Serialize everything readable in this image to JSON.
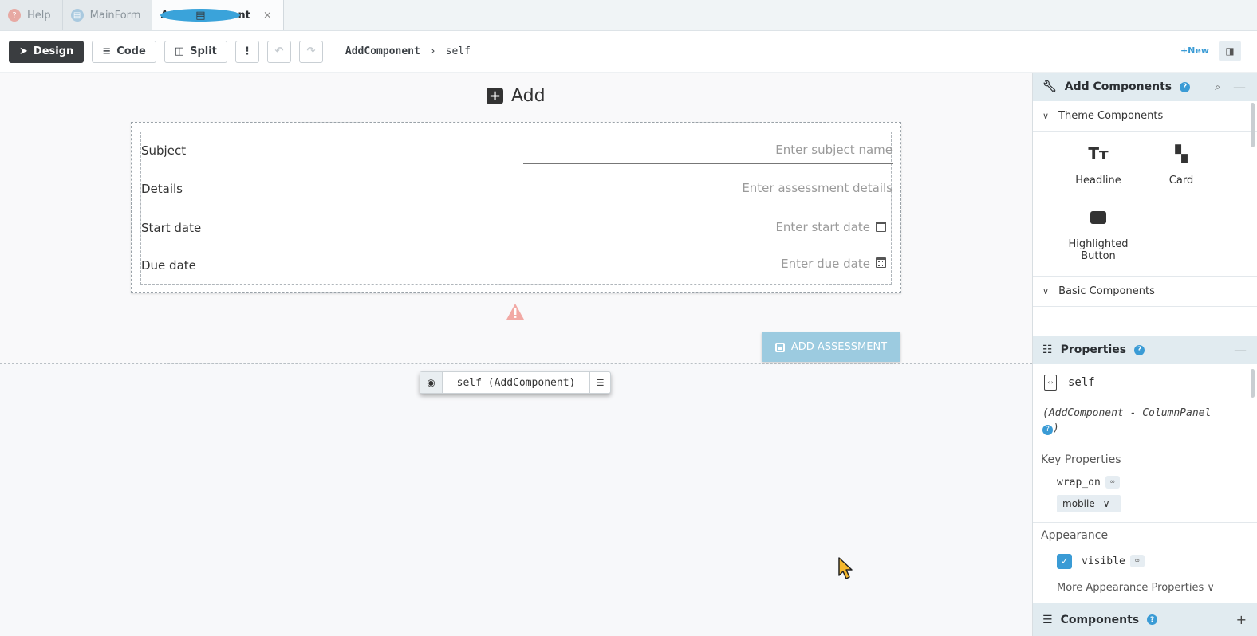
{
  "tabs": [
    {
      "label": "Help",
      "icon": "help-icon"
    },
    {
      "label": "MainForm",
      "icon": "form-icon"
    },
    {
      "label": "AddComponent",
      "icon": "component-icon",
      "close": "×"
    }
  ],
  "toolbar": {
    "design": "Design",
    "code": "Code",
    "split": "Split",
    "more": "⋮",
    "undo": "↶",
    "redo": "↷",
    "crumb_form": "AddComponent",
    "crumb_sep": "›",
    "crumb_self": "self",
    "new": "+New"
  },
  "form": {
    "title": "Add",
    "rows": [
      {
        "label": "Subject",
        "placeholder": "Enter subject name"
      },
      {
        "label": "Details",
        "placeholder": "Enter assessment details"
      },
      {
        "label": "Start date",
        "placeholder": "Enter start date"
      },
      {
        "label": "Due date",
        "placeholder": "Enter due date"
      }
    ],
    "button": "ADD ASSESSMENT",
    "selected": "self (AddComponent)"
  },
  "add_components": {
    "title": "Add Components",
    "help": "?",
    "theme_section": "Theme Components",
    "theme_items": [
      "Headline",
      "Card",
      "Highlighted Button"
    ],
    "basic_section": "Basic Components"
  },
  "properties": {
    "title": "Properties",
    "help": "?",
    "self_name": "self",
    "self_type": "(AddComponent - ColumnPanel",
    "self_type_end": ")",
    "key_group": "Key Properties",
    "wrap_on_label": "wrap_on",
    "wrap_on_value": "mobile",
    "appearance_group": "Appearance",
    "visible_label": "visible",
    "more_appearance": "More Appearance Properties"
  },
  "components_panel": {
    "title": "Components",
    "help": "?"
  },
  "colors": {
    "accent": "#3a9bd5",
    "button_disabled": "#9ccbe0",
    "panel_header": "#e1ebf0"
  }
}
